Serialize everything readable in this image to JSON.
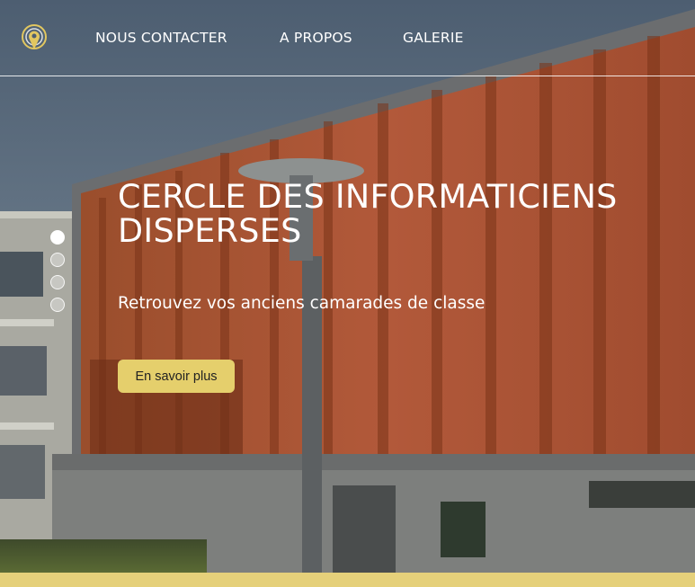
{
  "nav": {
    "logo_icon": "pin-target-logo-icon",
    "links": [
      "NOUS CONTACTER",
      "A PROPOS",
      "GALERIE"
    ]
  },
  "hero": {
    "title": "CERCLE DES INFORMATICIENS DISPERSES",
    "subtitle": "Retrouvez vos anciens camarades de classe",
    "cta_label": "En savoir plus",
    "slider": {
      "count": 4,
      "active_index": 0
    }
  },
  "colors": {
    "accent": "#e5cf6c",
    "accent_bar": "#e5d07a",
    "text": "#ffffff"
  }
}
